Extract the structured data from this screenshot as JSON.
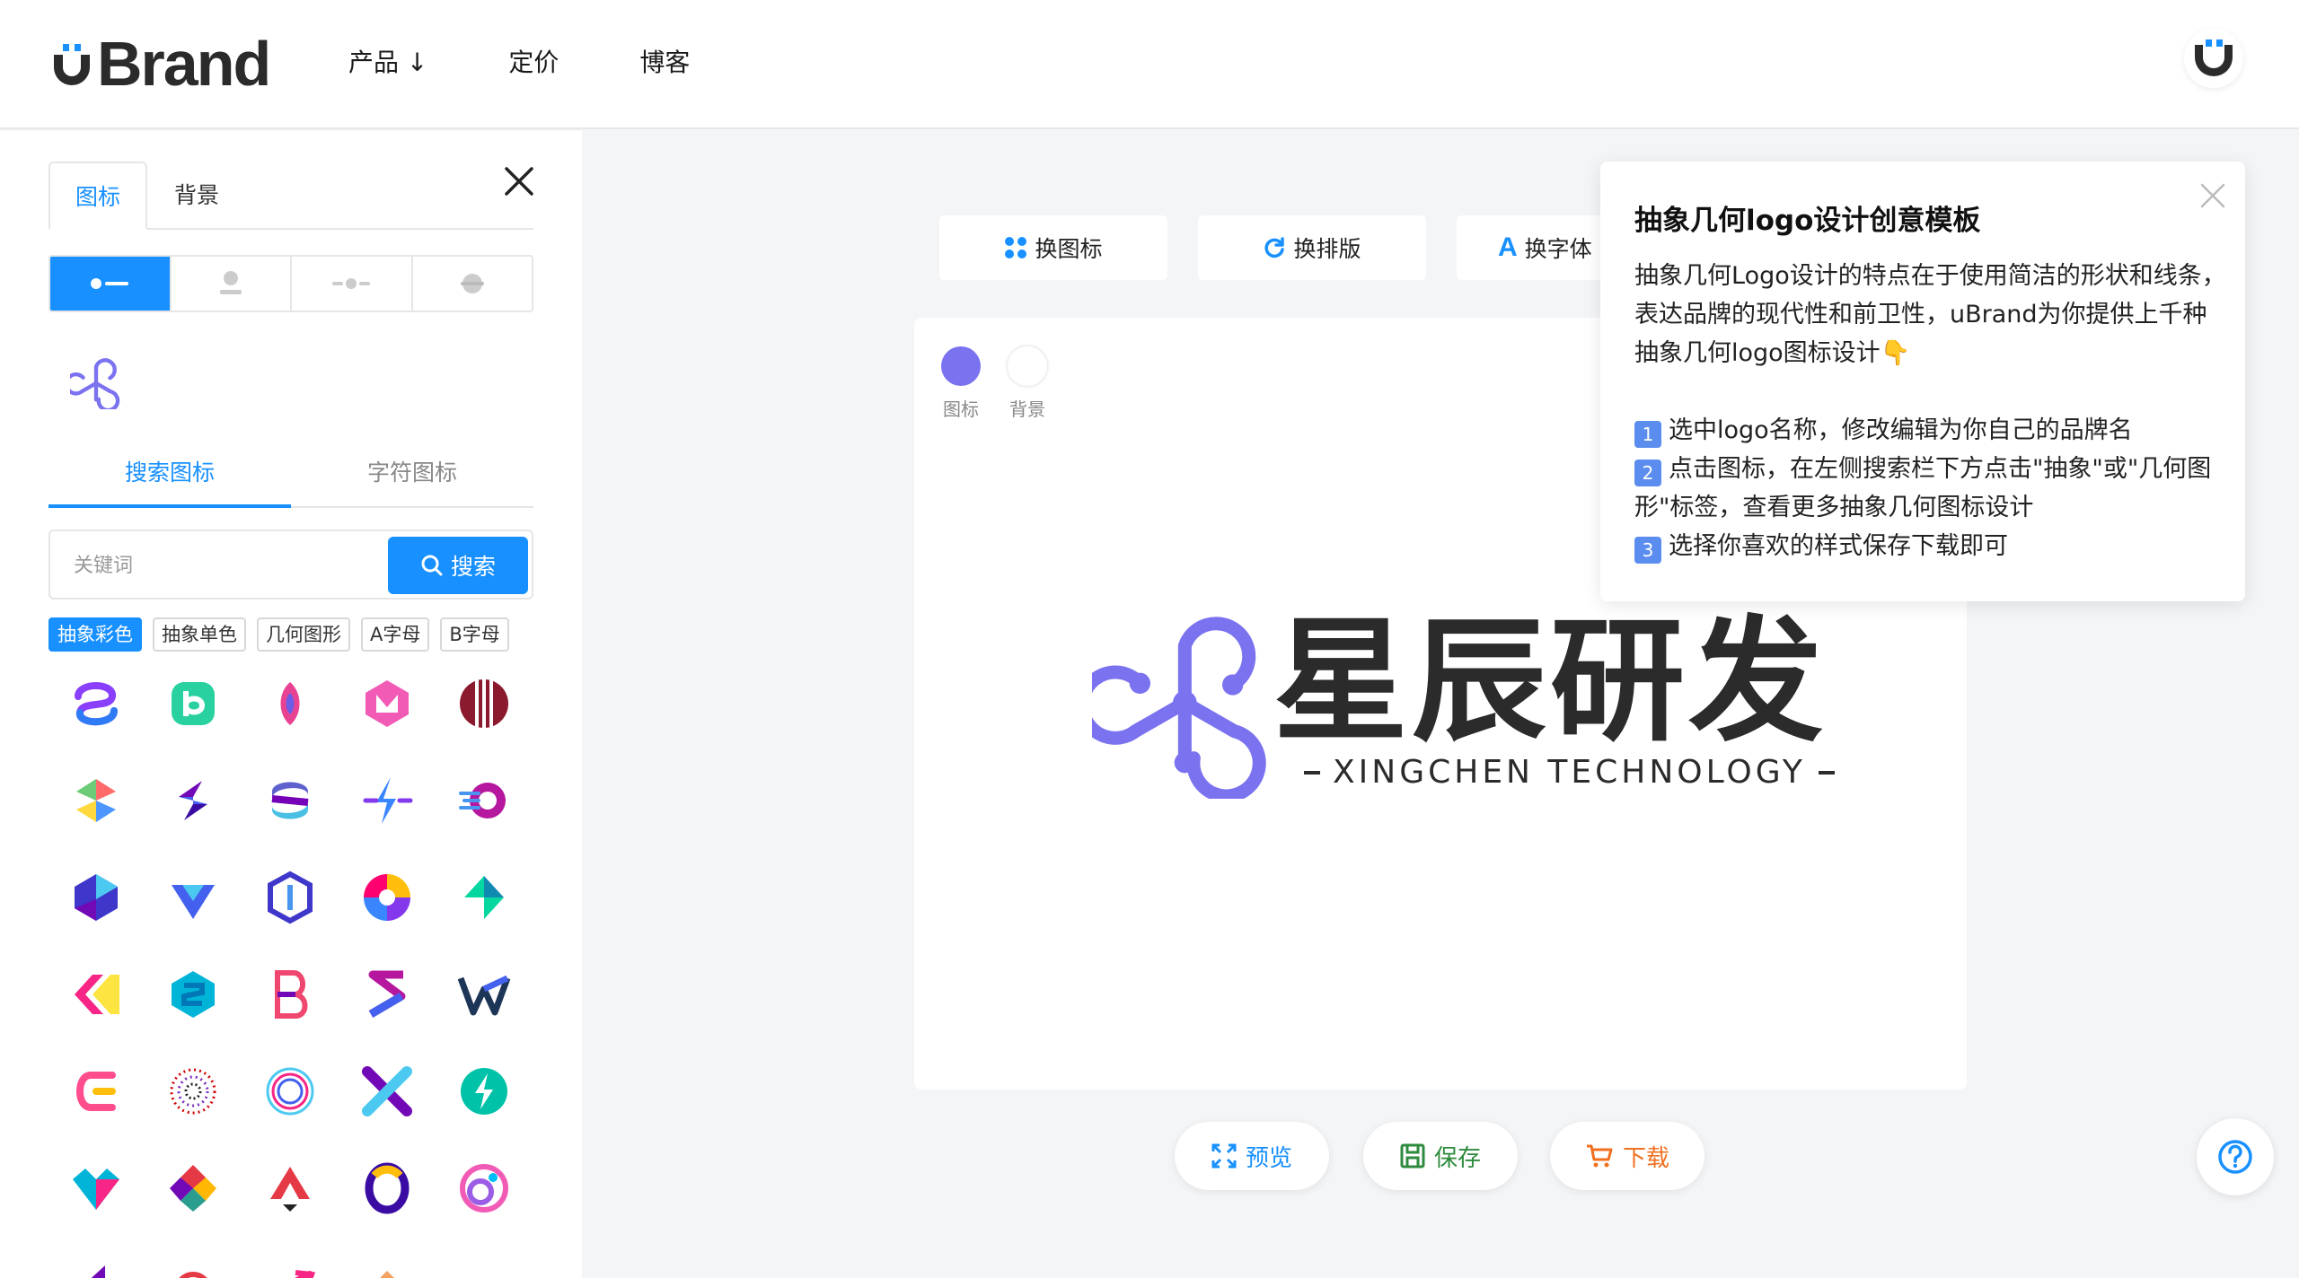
{
  "header": {
    "logo_text": "Brand",
    "nav": [
      "产品 ↓",
      "定价",
      "博客"
    ]
  },
  "sidebar": {
    "tabs": [
      "图标",
      "背景"
    ],
    "search_tabs": [
      "搜索图标",
      "字符图标"
    ],
    "search": {
      "placeholder": "关键词",
      "button": "搜索"
    },
    "tags": [
      "抽象彩色",
      "抽象单色",
      "几何图形",
      "A字母",
      "B字母"
    ]
  },
  "toolbar": {
    "change_icon": "换图标",
    "change_layout": "换排版",
    "change_font": "换字体"
  },
  "canvas": {
    "swatches": [
      {
        "label": "图标",
        "color": "#7b72f0"
      },
      {
        "label": "背景",
        "color": "#ffffff"
      }
    ],
    "brand_name": "星辰研发",
    "brand_sub": "XINGCHEN TECHNOLOGY"
  },
  "actions": {
    "preview": "预览",
    "save": "保存",
    "download": "下载"
  },
  "popup": {
    "title": "抽象几何logo设计创意模板",
    "intro": "抽象几何Logo设计的特点在于使用简洁的形状和线条，表达品牌的现代性和前卫性，uBrand为你提供上千种抽象几何logo图标设计👇",
    "steps": [
      {
        "num": "1",
        "text": "选中logo名称，修改编辑为你自己的品牌名"
      },
      {
        "num": "2",
        "text": "点击图标，在左侧搜索栏下方点击\"抽象\"或\"几何图形\"标签，查看更多抽象几何图标设计"
      },
      {
        "num": "3",
        "text": "选择你喜欢的样式保存下载即可"
      }
    ]
  },
  "colors": {
    "accent": "#1890ff",
    "brand_purple": "#7b72f0",
    "save_green": "#2e8b3d",
    "download_orange": "#f07020"
  }
}
